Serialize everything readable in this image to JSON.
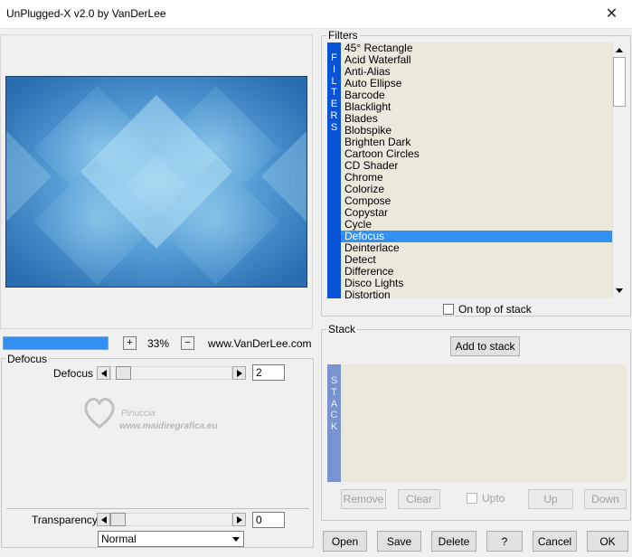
{
  "window": {
    "title": "UnPlugged-X v2.0 by VanDerLee",
    "close_glyph": "✕"
  },
  "preview": {
    "zoom_value": "33%",
    "zoom_in": "+",
    "zoom_out": "−",
    "site": "www.VanDerLee.com",
    "progress": 1.0
  },
  "defocus_group": {
    "title": "Defocus",
    "param_label": "Defocus",
    "param_value": "2",
    "watermark_line1": "Pinuccia",
    "watermark_line2": "www.maidiregrafica.eu"
  },
  "transparency": {
    "label": "Transparency",
    "value": "0",
    "blend_mode": "Normal"
  },
  "filters": {
    "title": "Filters",
    "side_letters": [
      "F",
      "I",
      "L",
      "T",
      "E",
      "R",
      "S"
    ],
    "items": [
      "45° Rectangle",
      "Acid Waterfall",
      "Anti-Alias",
      "Auto Ellipse",
      "Barcode",
      "Blacklight",
      "Blades",
      "Blobspike",
      "Brighten Dark",
      "Cartoon Circles",
      "CD Shader",
      "Chrome",
      "Colorize",
      "Compose",
      "Copystar",
      "Cycle",
      "Defocus",
      "Deinterlace",
      "Detect",
      "Difference",
      "Disco Lights",
      "Distortion"
    ],
    "selected": "Defocus",
    "on_top_label": "On top of stack"
  },
  "stack": {
    "title": "Stack",
    "add_label": "Add to stack",
    "side_letters": [
      "S",
      "T",
      "A",
      "C",
      "K"
    ],
    "remove_label": "Remove",
    "clear_label": "Clear",
    "upto_label": "Upto",
    "up_label": "Up",
    "down_label": "Down"
  },
  "bottom": {
    "open": "Open",
    "save": "Save",
    "delete": "Delete",
    "help": "?",
    "cancel": "Cancel",
    "ok": "OK"
  },
  "colors": {
    "selection": "#3290f0",
    "filters_side": "#0a52d6",
    "stack_side": "#7893cf",
    "list_bg": "#ebe8dc"
  }
}
